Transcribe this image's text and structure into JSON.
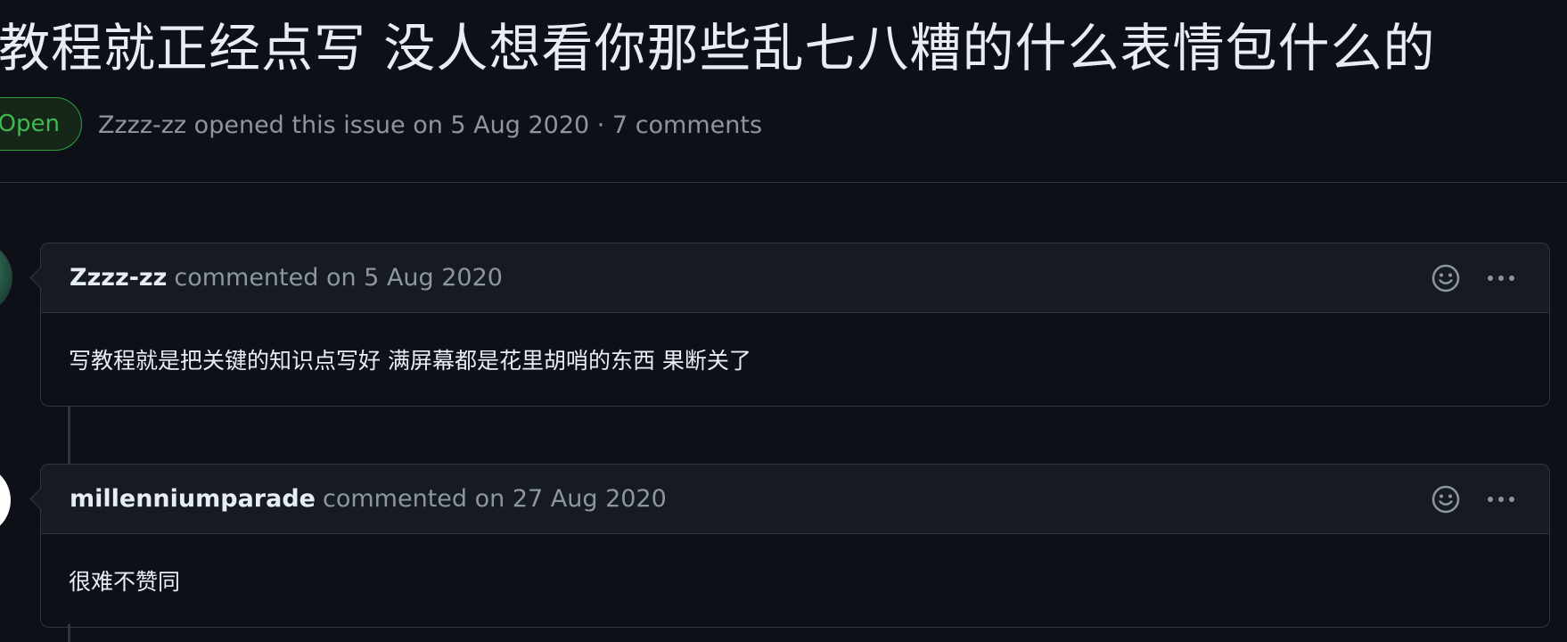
{
  "issue": {
    "title": "教程就正经点写 没人想看你那些乱七八糟的什么表情包什么的",
    "state": "Open",
    "meta": "Zzzz-zz opened this issue on 5 Aug 2020 · 7 comments"
  },
  "comments": [
    {
      "author": "Zzzz-zz",
      "meta": "commented on 5 Aug 2020",
      "body": "写教程就是把关键的知识点写好 满屏幕都是花里胡哨的东西 果断关了",
      "icons": [
        "smiley-icon",
        "kebab-horizontal-icon"
      ]
    },
    {
      "author": "millenniumparade",
      "meta": "commented on 27 Aug 2020",
      "body": "很难不赞同",
      "icons": [
        "smiley-icon",
        "kebab-horizontal-icon"
      ]
    }
  ],
  "colors": {
    "background": "#0d1117",
    "header_background": "#161b22",
    "border": "#30363d",
    "text": "#e6edf3",
    "muted_text": "#8d96a0",
    "open_green": "#3fb950"
  }
}
